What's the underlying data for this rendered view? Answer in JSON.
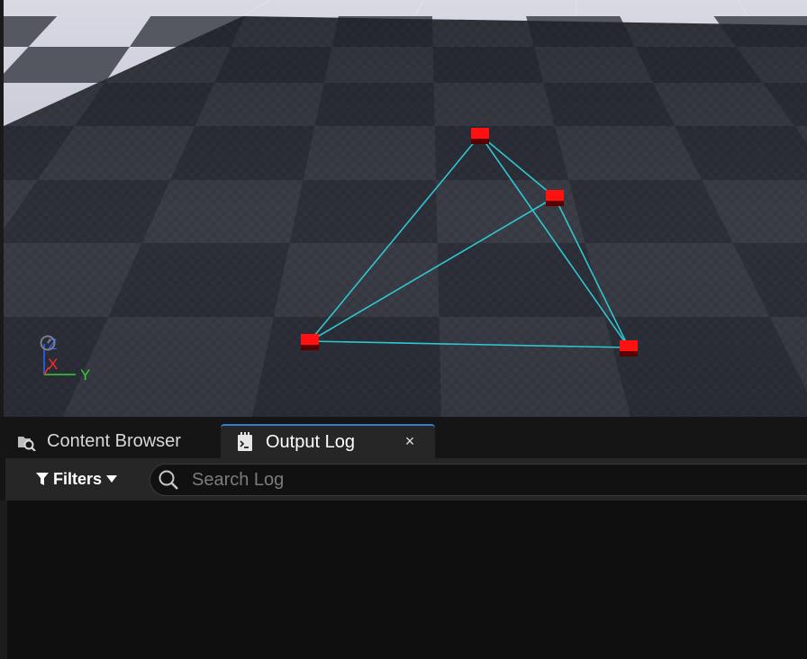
{
  "viewport": {
    "gizmo": {
      "z_label": "Z",
      "x_label": "X",
      "y_label": "Y"
    },
    "colors": {
      "line": "#2fc6d0",
      "point": "#ff1111",
      "axis_z": "#2f63ff",
      "axis_x": "#ff2a2a",
      "axis_y": "#35d12f"
    }
  },
  "tabs": {
    "content_browser": {
      "label": "Content Browser",
      "icon": "content-browser-icon"
    },
    "output_log": {
      "label": "Output Log",
      "icon": "output-log-icon",
      "active": true,
      "close": "×"
    }
  },
  "toolbar": {
    "filters_label": "Filters",
    "search_placeholder": "Search Log"
  },
  "log": {
    "lines": []
  }
}
